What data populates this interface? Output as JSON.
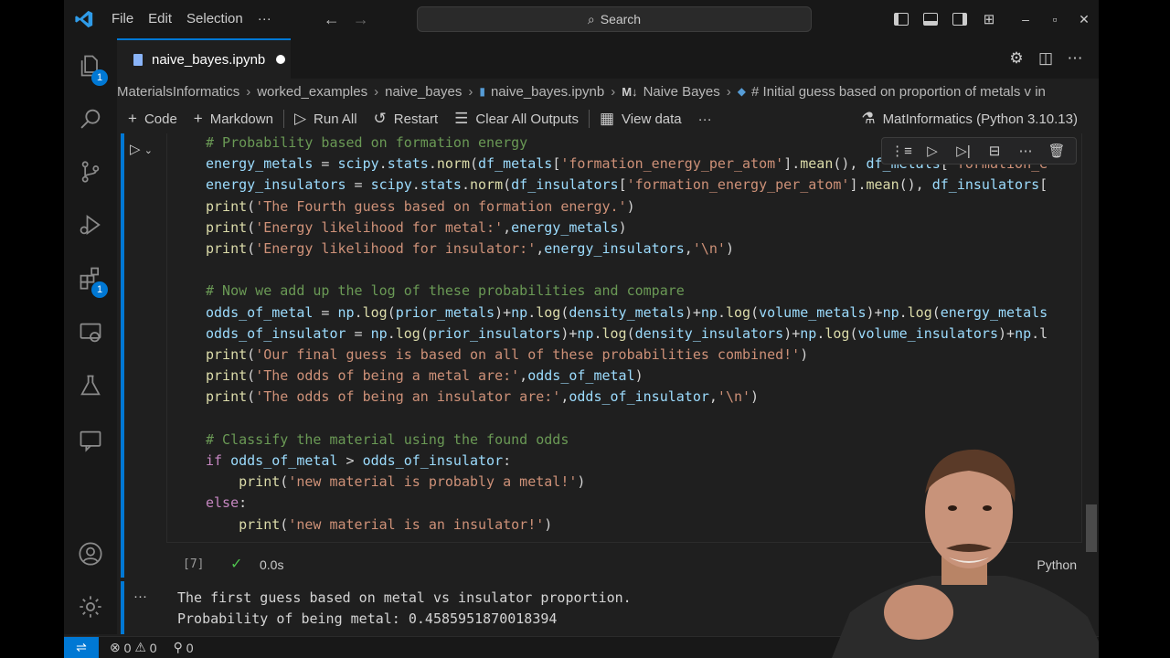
{
  "titlebar": {
    "menu": [
      "File",
      "Edit",
      "Selection",
      "···"
    ],
    "search_placeholder": "Search"
  },
  "tab": {
    "filename": "naive_bayes.ipynb"
  },
  "breadcrumb": {
    "items": [
      "MaterialsInformatics",
      "worked_examples",
      "naive_bayes",
      "naive_bayes.ipynb",
      "Naive Bayes",
      "# Initial guess based on proportion of metals v in"
    ],
    "md_badge": "M↓"
  },
  "toolbar": {
    "code": "Code",
    "markdown": "Markdown",
    "run_all": "Run All",
    "restart": "Restart",
    "clear_outputs": "Clear All Outputs",
    "view_data": "View data",
    "more": "···",
    "kernel": "MatInformatics (Python 3.10.13)"
  },
  "activity": {
    "explorer_badge": "1",
    "extensions_badge": "1"
  },
  "cell": {
    "lines": [
      [
        [
          "t-com",
          "# Probability based on formation energy"
        ]
      ],
      [
        [
          "t-var",
          "energy_metals"
        ],
        [
          "t-plain",
          " = "
        ],
        [
          "t-var",
          "scipy"
        ],
        [
          "t-plain",
          "."
        ],
        [
          "t-var",
          "stats"
        ],
        [
          "t-plain",
          "."
        ],
        [
          "t-fn",
          "norm"
        ],
        [
          "t-plain",
          "("
        ],
        [
          "t-var",
          "df_metals"
        ],
        [
          "t-plain",
          "["
        ],
        [
          "t-str",
          "'formation_energy_per_atom'"
        ],
        [
          "t-plain",
          "]."
        ],
        [
          "t-fn",
          "mean"
        ],
        [
          "t-plain",
          "(), "
        ],
        [
          "t-var",
          "df_metals"
        ],
        [
          "t-plain",
          "["
        ],
        [
          "t-str",
          "'formation_e"
        ]
      ],
      [
        [
          "t-var",
          "energy_insulators"
        ],
        [
          "t-plain",
          " = "
        ],
        [
          "t-var",
          "scipy"
        ],
        [
          "t-plain",
          "."
        ],
        [
          "t-var",
          "stats"
        ],
        [
          "t-plain",
          "."
        ],
        [
          "t-fn",
          "norm"
        ],
        [
          "t-plain",
          "("
        ],
        [
          "t-var",
          "df_insulators"
        ],
        [
          "t-plain",
          "["
        ],
        [
          "t-str",
          "'formation_energy_per_atom'"
        ],
        [
          "t-plain",
          "]."
        ],
        [
          "t-fn",
          "mean"
        ],
        [
          "t-plain",
          "(), "
        ],
        [
          "t-var",
          "df_insulators"
        ],
        [
          "t-plain",
          "["
        ]
      ],
      [
        [
          "t-fn",
          "print"
        ],
        [
          "t-plain",
          "("
        ],
        [
          "t-str",
          "'The Fourth guess based on formation energy.'"
        ],
        [
          "t-plain",
          ")"
        ]
      ],
      [
        [
          "t-fn",
          "print"
        ],
        [
          "t-plain",
          "("
        ],
        [
          "t-str",
          "'Energy likelihood for metal:'"
        ],
        [
          "t-plain",
          ","
        ],
        [
          "t-var",
          "energy_metals"
        ],
        [
          "t-plain",
          ")"
        ]
      ],
      [
        [
          "t-fn",
          "print"
        ],
        [
          "t-plain",
          "("
        ],
        [
          "t-str",
          "'Energy likelihood for insulator:'"
        ],
        [
          "t-plain",
          ","
        ],
        [
          "t-var",
          "energy_insulators"
        ],
        [
          "t-plain",
          ","
        ],
        [
          "t-str",
          "'\\n'"
        ],
        [
          "t-plain",
          ")"
        ]
      ],
      [],
      [
        [
          "t-com",
          "# Now we add up the log of these probabilities and compare"
        ]
      ],
      [
        [
          "t-var",
          "odds_of_metal"
        ],
        [
          "t-plain",
          " = "
        ],
        [
          "t-var",
          "np"
        ],
        [
          "t-plain",
          "."
        ],
        [
          "t-fn",
          "log"
        ],
        [
          "t-plain",
          "("
        ],
        [
          "t-var",
          "prior_metals"
        ],
        [
          "t-plain",
          ")+"
        ],
        [
          "t-var",
          "np"
        ],
        [
          "t-plain",
          "."
        ],
        [
          "t-fn",
          "log"
        ],
        [
          "t-plain",
          "("
        ],
        [
          "t-var",
          "density_metals"
        ],
        [
          "t-plain",
          ")+"
        ],
        [
          "t-var",
          "np"
        ],
        [
          "t-plain",
          "."
        ],
        [
          "t-fn",
          "log"
        ],
        [
          "t-plain",
          "("
        ],
        [
          "t-var",
          "volume_metals"
        ],
        [
          "t-plain",
          ")+"
        ],
        [
          "t-var",
          "np"
        ],
        [
          "t-plain",
          "."
        ],
        [
          "t-fn",
          "log"
        ],
        [
          "t-plain",
          "("
        ],
        [
          "t-var",
          "energy_metals"
        ]
      ],
      [
        [
          "t-var",
          "odds_of_insulator"
        ],
        [
          "t-plain",
          " = "
        ],
        [
          "t-var",
          "np"
        ],
        [
          "t-plain",
          "."
        ],
        [
          "t-fn",
          "log"
        ],
        [
          "t-plain",
          "("
        ],
        [
          "t-var",
          "prior_insulators"
        ],
        [
          "t-plain",
          ")+"
        ],
        [
          "t-var",
          "np"
        ],
        [
          "t-plain",
          "."
        ],
        [
          "t-fn",
          "log"
        ],
        [
          "t-plain",
          "("
        ],
        [
          "t-var",
          "density_insulators"
        ],
        [
          "t-plain",
          ")+"
        ],
        [
          "t-var",
          "np"
        ],
        [
          "t-plain",
          "."
        ],
        [
          "t-fn",
          "log"
        ],
        [
          "t-plain",
          "("
        ],
        [
          "t-var",
          "volume_insulators"
        ],
        [
          "t-plain",
          ")+"
        ],
        [
          "t-var",
          "np"
        ],
        [
          "t-plain",
          ".l"
        ]
      ],
      [
        [
          "t-fn",
          "print"
        ],
        [
          "t-plain",
          "("
        ],
        [
          "t-str",
          "'Our final guess is based on all of these probabilities combined!'"
        ],
        [
          "t-plain",
          ")"
        ]
      ],
      [
        [
          "t-fn",
          "print"
        ],
        [
          "t-plain",
          "("
        ],
        [
          "t-str",
          "'The odds of being a metal are:'"
        ],
        [
          "t-plain",
          ","
        ],
        [
          "t-var",
          "odds_of_metal"
        ],
        [
          "t-plain",
          ")"
        ]
      ],
      [
        [
          "t-fn",
          "print"
        ],
        [
          "t-plain",
          "("
        ],
        [
          "t-str",
          "'The odds of being an insulator are:'"
        ],
        [
          "t-plain",
          ","
        ],
        [
          "t-var",
          "odds_of_insulator"
        ],
        [
          "t-plain",
          ","
        ],
        [
          "t-str",
          "'\\n'"
        ],
        [
          "t-plain",
          ")"
        ]
      ],
      [],
      [
        [
          "t-com",
          "# Classify the material using the found odds"
        ]
      ],
      [
        [
          "t-kw",
          "if"
        ],
        [
          "t-plain",
          " "
        ],
        [
          "t-var",
          "odds_of_metal"
        ],
        [
          "t-plain",
          " > "
        ],
        [
          "t-var",
          "odds_of_insulator"
        ],
        [
          "t-plain",
          ":"
        ]
      ],
      [
        [
          "t-plain",
          "    "
        ],
        [
          "t-fn",
          "print"
        ],
        [
          "t-plain",
          "("
        ],
        [
          "t-str",
          "'new material is probably a metal!'"
        ],
        [
          "t-plain",
          ")"
        ]
      ],
      [
        [
          "t-kw",
          "else"
        ],
        [
          "t-plain",
          ":"
        ]
      ],
      [
        [
          "t-plain",
          "    "
        ],
        [
          "t-fn",
          "print"
        ],
        [
          "t-plain",
          "("
        ],
        [
          "t-str",
          "'new material is an insulator!'"
        ],
        [
          "t-plain",
          ")"
        ]
      ]
    ],
    "exec_count": "[7]",
    "exec_time": "0.0s",
    "language": "Python"
  },
  "output": {
    "lines": [
      "The first guess based on metal vs insulator proportion.",
      "Probability of being metal: 0.4585951870018394"
    ]
  },
  "statusbar": {
    "errors": "0",
    "warnings": "0",
    "ports": "0"
  }
}
